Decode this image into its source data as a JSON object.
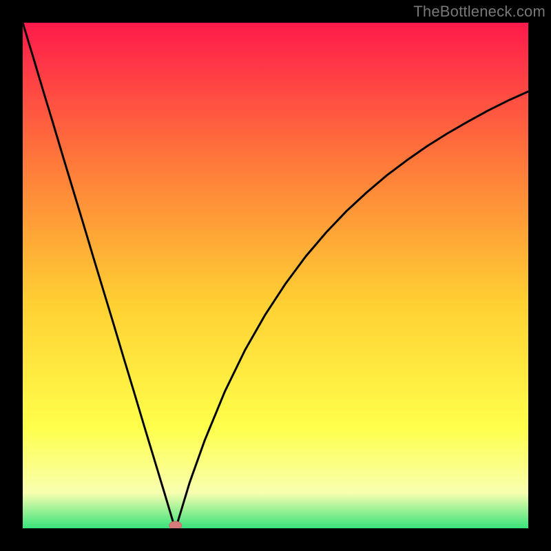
{
  "watermark": "TheBottleneck.com",
  "colors": {
    "bg": "#000000",
    "curve": "#000000",
    "marker_fill": "#d77a7a",
    "marker_stroke": "#c96b6b",
    "grad_top": "#ff1a4b",
    "grad_mid1": "#ff7a3a",
    "grad_mid2": "#ffcf33",
    "grad_mid3": "#ffff4a",
    "grad_pale": "#f8ffb0",
    "grad_bottom": "#39e27a"
  },
  "chart_data": {
    "type": "line",
    "title": "",
    "xlabel": "",
    "ylabel": "",
    "x": [
      0.0,
      0.02,
      0.04,
      0.06,
      0.08,
      0.1,
      0.12,
      0.14,
      0.16,
      0.18,
      0.2,
      0.22,
      0.24,
      0.26,
      0.28,
      0.3,
      0.302,
      0.304,
      0.33,
      0.36,
      0.4,
      0.44,
      0.48,
      0.52,
      0.56,
      0.6,
      0.64,
      0.68,
      0.72,
      0.76,
      0.8,
      0.84,
      0.88,
      0.92,
      0.96,
      1.0
    ],
    "values": [
      1.0,
      0.934,
      0.867,
      0.801,
      0.734,
      0.668,
      0.602,
      0.535,
      0.469,
      0.403,
      0.336,
      0.27,
      0.203,
      0.137,
      0.071,
      0.004,
      0.0,
      0.004,
      0.09,
      0.174,
      0.271,
      0.353,
      0.423,
      0.484,
      0.538,
      0.585,
      0.627,
      0.664,
      0.698,
      0.728,
      0.756,
      0.781,
      0.804,
      0.826,
      0.846,
      0.864
    ],
    "xlim": [
      0,
      1
    ],
    "ylim": [
      0,
      1
    ],
    "marker": {
      "x": 0.302,
      "y": 0.0
    },
    "legend": [],
    "grid": false
  }
}
